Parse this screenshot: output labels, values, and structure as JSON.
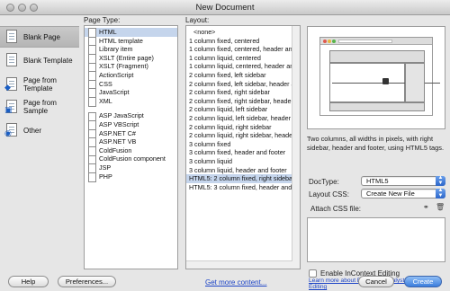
{
  "window": {
    "title": "New Document"
  },
  "categories": [
    {
      "label": "Blank Page",
      "icon": "blank-page-icon",
      "active": true
    },
    {
      "label": "Blank Template",
      "icon": "blank-template-icon",
      "active": false
    },
    {
      "label": "Page from Template",
      "icon": "page-from-template-icon",
      "active": false
    },
    {
      "label": "Page from Sample",
      "icon": "page-from-sample-icon",
      "active": false
    },
    {
      "label": "Other",
      "icon": "other-icon",
      "active": false
    }
  ],
  "page_type": {
    "heading": "Page Type:",
    "groups": [
      [
        "HTML",
        "HTML template",
        "Library item",
        "XSLT (Entire page)",
        "XSLT (Fragment)",
        "ActionScript",
        "CSS",
        "JavaScript",
        "XML"
      ],
      [
        "ASP JavaScript",
        "ASP VBScript",
        "ASP.NET C#",
        "ASP.NET VB",
        "ColdFusion",
        "ColdFusion component",
        "JSP",
        "PHP"
      ]
    ],
    "selected": "HTML"
  },
  "layout": {
    "heading": "Layout:",
    "items": [
      "<none>",
      "1 column fixed, centered",
      "1 column fixed, centered, header and fo",
      "1 column liquid, centered",
      "1 column liquid, centered, header and fo",
      "2 column fixed, left sidebar",
      "2 column fixed, left sidebar, header and",
      "2 column fixed, right sidebar",
      "2 column fixed, right sidebar, header an",
      "2 column liquid, left sidebar",
      "2 column liquid, left sidebar, header and",
      "2 column liquid, right sidebar",
      "2 column liquid, right sidebar, header an",
      "3 column fixed",
      "3 column fixed, header and footer",
      "3 column liquid",
      "3 column liquid, header and footer",
      "HTML5: 2 column fixed, right sidebar, hea",
      "HTML5: 3 column fixed, header and foote"
    ],
    "selected": "HTML5: 2 column fixed, right sidebar, hea"
  },
  "preview": {
    "description": "Two columns, all widths in pixels, with right sidebar, header and footer, using HTML5 tags."
  },
  "form": {
    "doctype_label": "DocType:",
    "doctype_value": "HTML5",
    "layout_css_label": "Layout CSS:",
    "layout_css_value": "Create New File",
    "attach_css_label": "Attach CSS file:",
    "incontext_label": "Enable InContext Editing",
    "incontext_link": "Learn more about Business Catalyst InContext Editing"
  },
  "buttons": {
    "help": "Help",
    "preferences": "Preferences...",
    "get_more": "Get more content...",
    "cancel": "Cancel",
    "create": "Create"
  },
  "colors": {
    "selection": "#3875d7",
    "primary_button": "#3b7ddd",
    "link": "#1c44c7"
  }
}
